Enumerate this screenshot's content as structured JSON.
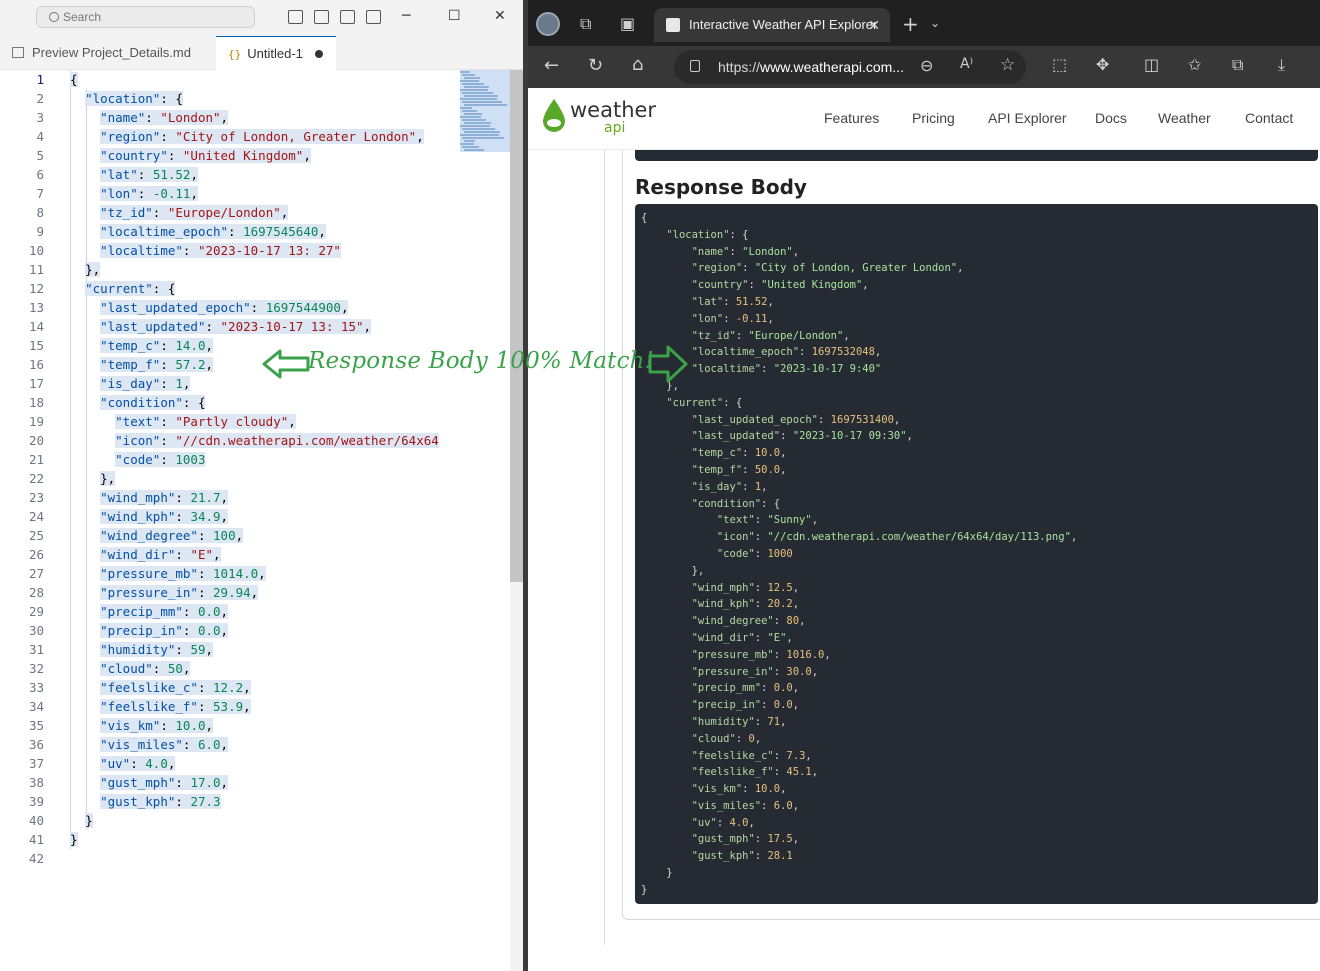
{
  "vscode": {
    "search_label": "Search",
    "tabs": [
      {
        "label": "Preview Project_Details.md"
      },
      {
        "label": "Untitled-1"
      }
    ],
    "line_numbers": [
      "1",
      "2",
      "3",
      "4",
      "5",
      "6",
      "7",
      "8",
      "9",
      "10",
      "11",
      "12",
      "13",
      "14",
      "15",
      "16",
      "17",
      "18",
      "19",
      "20",
      "21",
      "22",
      "23",
      "24",
      "25",
      "26",
      "27",
      "28",
      "29",
      "30",
      "31",
      "32",
      "33",
      "34",
      "35",
      "36",
      "37",
      "38",
      "39",
      "40",
      "41",
      "42"
    ],
    "code_lines": [
      "{",
      "  \"location\": {",
      "    \"name\": \"London\",",
      "    \"region\": \"City of London, Greater London\",",
      "    \"country\": \"United Kingdom\",",
      "    \"lat\": 51.52,",
      "    \"lon\": -0.11,",
      "    \"tz_id\": \"Europe/London\",",
      "    \"localtime_epoch\": 1697545640,",
      "    \"localtime\": \"2023-10-17 13: 27\"",
      "  },",
      "  \"current\": {",
      "    \"last_updated_epoch\": 1697544900,",
      "    \"last_updated\": \"2023-10-17 13: 15\",",
      "    \"temp_c\": 14.0,",
      "    \"temp_f\": 57.2,",
      "    \"is_day\": 1,",
      "    \"condition\": {",
      "      \"text\": \"Partly cloudy\",",
      "      \"icon\": \"//cdn.weatherapi.com/weather/64x64",
      "      \"code\": 1003",
      "    },",
      "    \"wind_mph\": 21.7,",
      "    \"wind_kph\": 34.9,",
      "    \"wind_degree\": 100,",
      "    \"wind_dir\": \"E\",",
      "    \"pressure_mb\": 1014.0,",
      "    \"pressure_in\": 29.94,",
      "    \"precip_mm\": 0.0,",
      "    \"precip_in\": 0.0,",
      "    \"humidity\": 59,",
      "    \"cloud\": 50,",
      "    \"feelslike_c\": 12.2,",
      "    \"feelslike_f\": 53.9,",
      "    \"vis_km\": 10.0,",
      "    \"vis_miles\": 6.0,",
      "    \"uv\": 4.0,",
      "    \"gust_mph\": 17.0,",
      "    \"gust_kph\": 27.3",
      "  }",
      "}",
      ""
    ]
  },
  "browser": {
    "tab_title": "Interactive Weather API Explorer",
    "address_prefix": "https://",
    "address_host": "www.weatherapi.com...",
    "site": {
      "logo_main": "weather",
      "logo_sub": "api",
      "nav": [
        "Features",
        "Pricing",
        "API Explorer",
        "Docs",
        "Weather",
        "Contact"
      ]
    },
    "response_title": "Response Body",
    "response_lines": [
      "{",
      "    \"location\": {",
      "        \"name\": \"London\",",
      "        \"region\": \"City of London, Greater London\",",
      "        \"country\": \"United Kingdom\",",
      "        \"lat\": 51.52,",
      "        \"lon\": -0.11,",
      "        \"tz_id\": \"Europe/London\",",
      "        \"localtime_epoch\": 1697532048,",
      "        \"localtime\": \"2023-10-17 9:40\"",
      "    },",
      "    \"current\": {",
      "        \"last_updated_epoch\": 1697531400,",
      "        \"last_updated\": \"2023-10-17 09:30\",",
      "        \"temp_c\": 10.0,",
      "        \"temp_f\": 50.0,",
      "        \"is_day\": 1,",
      "        \"condition\": {",
      "            \"text\": \"Sunny\",",
      "            \"icon\": \"//cdn.weatherapi.com/weather/64x64/day/113.png\",",
      "            \"code\": 1000",
      "        },",
      "        \"wind_mph\": 12.5,",
      "        \"wind_kph\": 20.2,",
      "        \"wind_degree\": 80,",
      "        \"wind_dir\": \"E\",",
      "        \"pressure_mb\": 1016.0,",
      "        \"pressure_in\": 30.0,",
      "        \"precip_mm\": 0.0,",
      "        \"precip_in\": 0.0,",
      "        \"humidity\": 71,",
      "        \"cloud\": 0,",
      "        \"feelslike_c\": 7.3,",
      "        \"feelslike_f\": 45.1,",
      "        \"vis_km\": 10.0,",
      "        \"vis_miles\": 6.0,",
      "        \"uv\": 4.0,",
      "        \"gust_mph\": 17.5,",
      "        \"gust_kph\": 28.1",
      "    }",
      "}"
    ]
  },
  "annotation": {
    "text": "Response Body 100% Match!"
  },
  "colors": {
    "json_key": "#0451a5",
    "json_string": "#a31515",
    "json_number": "#098658",
    "annotation_green": "#3aa24a",
    "code_panel_bg": "#262b33"
  }
}
